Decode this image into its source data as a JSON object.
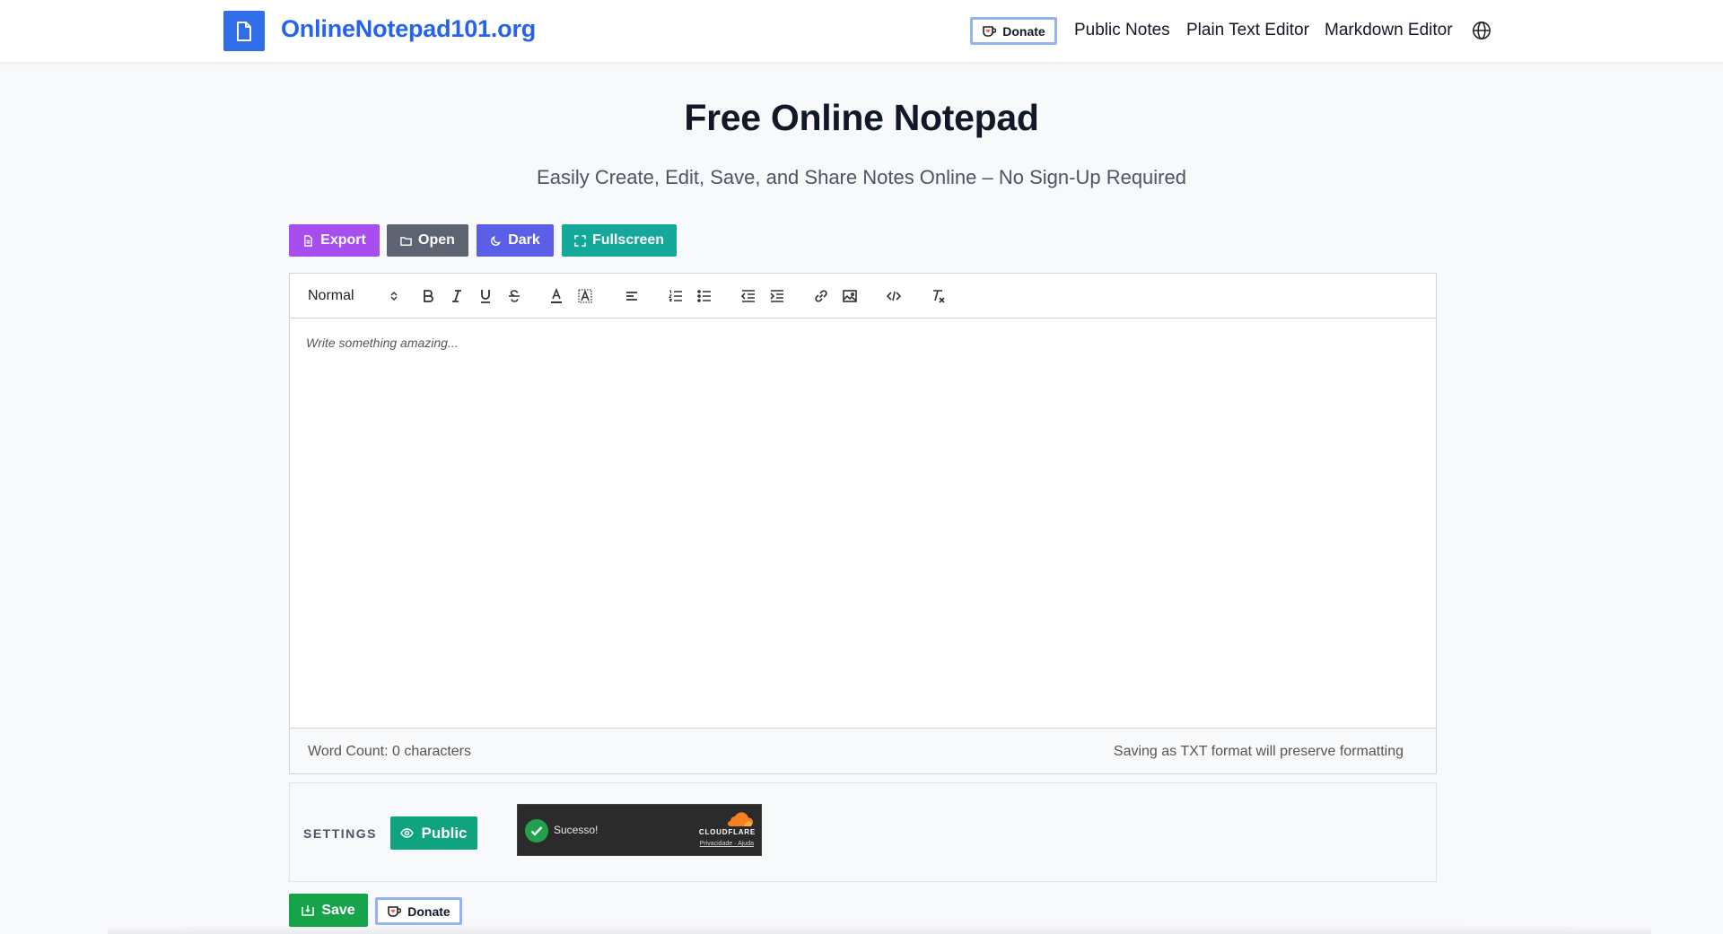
{
  "header": {
    "site_name": "OnlineNotepad101.org",
    "donate_label": "Donate",
    "nav": [
      "Public Notes",
      "Plain Text Editor",
      "Markdown Editor"
    ],
    "language_icon": "globe-icon"
  },
  "hero": {
    "title": "Free Online Notepad",
    "subtitle": "Easily Create, Edit, Save, and Share Notes Online – No Sign-Up Required"
  },
  "actions": {
    "export_label": "Export",
    "open_label": "Open",
    "dark_label": "Dark",
    "fullscreen_label": "Fullscreen",
    "colors": {
      "export": "#a74ef0",
      "open": "#5b6470",
      "dark": "#5b5ee6",
      "fullscreen": "#14a89a"
    }
  },
  "editor": {
    "format_value": "Normal",
    "toolbar_icons": [
      "bold-icon",
      "italic-icon",
      "underline-icon",
      "strikethrough-icon",
      "text-color-icon",
      "background-color-icon",
      "align-icon",
      "ordered-list-icon",
      "bullet-list-icon",
      "outdent-icon",
      "indent-icon",
      "link-icon",
      "image-icon",
      "code-icon",
      "clear-format-icon"
    ],
    "placeholder": "Write something amazing..."
  },
  "status": {
    "word_count": "Word Count: 0 characters",
    "format_note": "Saving as TXT format will preserve formatting"
  },
  "settings": {
    "label": "SETTINGS",
    "visibility_label": "Public",
    "captcha": {
      "status_text": "Sucesso!",
      "brand": "CLOUDFLARE",
      "links": "Privacidade  ·  Ajuda"
    }
  },
  "footer_actions": {
    "save_label": "Save",
    "donate_label": "Donate"
  },
  "colors": {
    "brand_blue": "#2563eb",
    "save_green": "#16a34a",
    "public_green": "#10a37f"
  }
}
